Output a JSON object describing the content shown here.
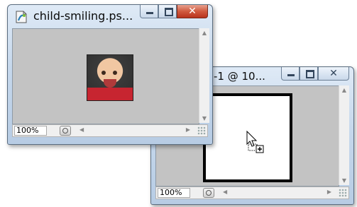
{
  "front_window": {
    "title": "child-smiling.ps...",
    "zoom": "100%",
    "image": "baby-photo"
  },
  "back_window": {
    "title": "-1 @ 10...",
    "zoom": "100%"
  },
  "icons": {
    "app": "photoshop-document-icon",
    "minimize": "minimize-icon",
    "maximize": "maximize-icon",
    "close": "close-icon",
    "cursor": "drag-copy-cursor-icon"
  },
  "colors": {
    "close_button": "#d05a3f",
    "canvas_bg": "#c3c3c3",
    "title_bar": "#c6d8ec"
  }
}
